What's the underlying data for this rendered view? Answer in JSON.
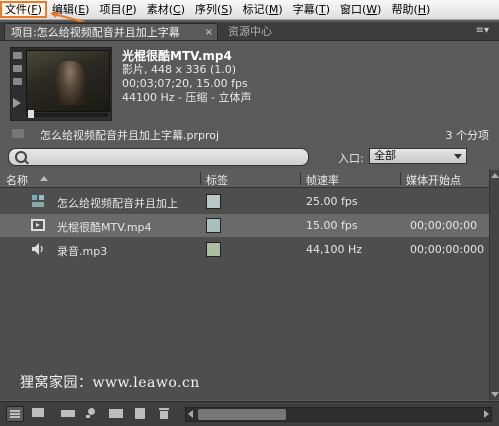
{
  "menu": [
    {
      "label": "文件",
      "hotkey": "F"
    },
    {
      "label": "编辑",
      "hotkey": "E"
    },
    {
      "label": "项目",
      "hotkey": "P"
    },
    {
      "label": "素材",
      "hotkey": "C"
    },
    {
      "label": "序列",
      "hotkey": "S"
    },
    {
      "label": "标记",
      "hotkey": "M"
    },
    {
      "label": "字幕",
      "hotkey": "T"
    },
    {
      "label": "窗口",
      "hotkey": "W"
    },
    {
      "label": "帮助",
      "hotkey": "H"
    }
  ],
  "tabs": {
    "project": "项目:怎么给视频配音并且加上字幕",
    "close": "×",
    "resource": "资源中心",
    "menu_glyph": "≡▾"
  },
  "preview": {
    "filename": "光棍很酷MTV.mp4",
    "line1": "影片, 448 x 336 (1.0)",
    "line2": "00;03;07;20, 15.00 fps",
    "line3": "44100 Hz - 压缩 - 立体声"
  },
  "project": {
    "file": "怎么给视频配音并且加上字幕.prproj",
    "count": "3 个分项"
  },
  "filter": {
    "in_label": "入口:",
    "in_value": "全部"
  },
  "columns": [
    "名称",
    "标签",
    "帧速率",
    "媒体开始点"
  ],
  "rows": [
    {
      "name": "怎么给视频配音并且加上",
      "fps": "25.00 fps",
      "start": "",
      "swatch": "#b7c8c8",
      "icon": "sequence-icon"
    },
    {
      "name": "光棍很酷MTV.mp4",
      "fps": "15.00 fps",
      "start": "00;00;00;00",
      "swatch": "#a8c0bc",
      "icon": "video-audio-icon"
    },
    {
      "name": "录音.mp3",
      "fps": "44,100 Hz",
      "start": "00;00;00:000",
      "swatch": "#a8c0a0",
      "icon": "audio-icon"
    }
  ],
  "watermark": "狸窝家园：www.leawo.cn",
  "accent": "#f07820"
}
